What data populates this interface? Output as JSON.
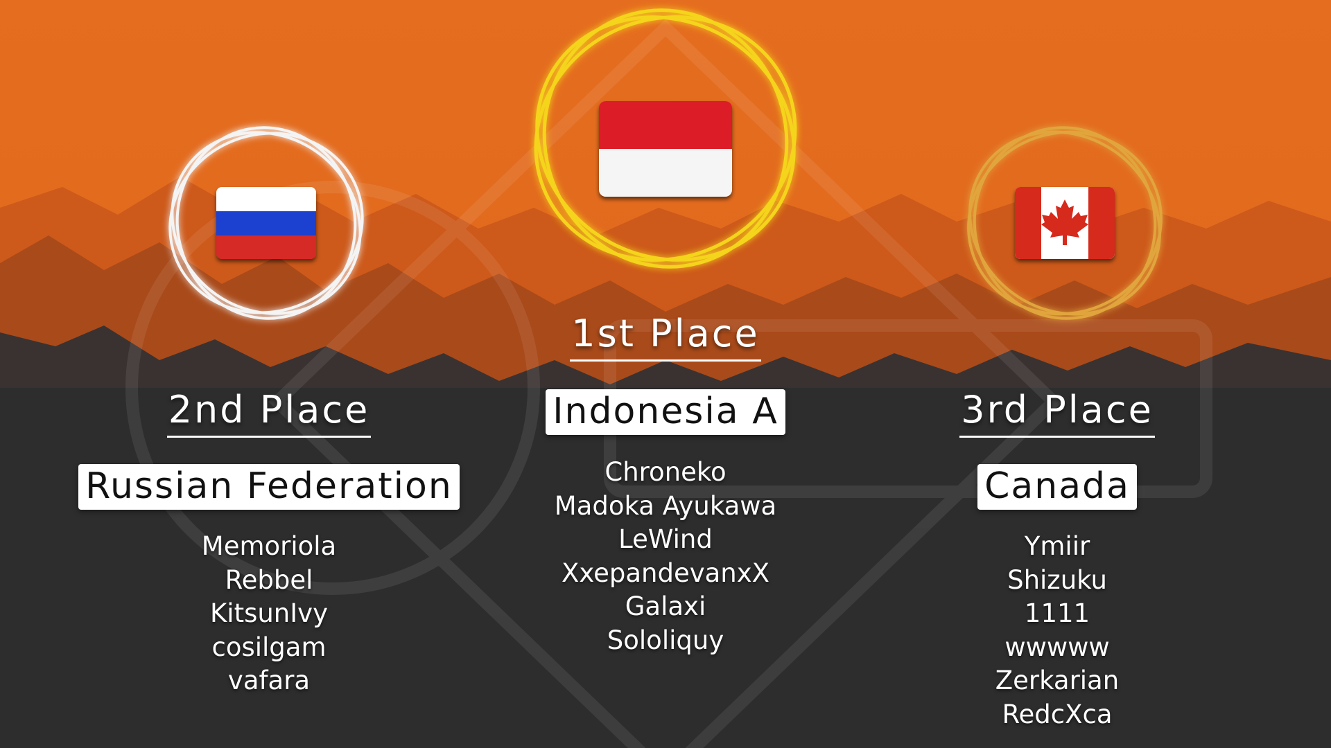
{
  "podiums": {
    "first": {
      "place": "1st Place",
      "team": "Indonesia A",
      "flag": "indonesia-flag",
      "ring_color": "#f2d22c",
      "players": [
        "Chroneko",
        "Madoka Ayukawa",
        "LeWind",
        "XxepandevanxX",
        "Galaxi",
        "Sololiquy"
      ]
    },
    "second": {
      "place": "2nd Place",
      "team": "Russian Federation",
      "flag": "russia-flag",
      "ring_color": "#e8e8e8",
      "players": [
        "Memoriola",
        "Rebbel",
        "KitsunIvy",
        "cosilgam",
        "vafara"
      ]
    },
    "third": {
      "place": "3rd Place",
      "team": "Canada",
      "flag": "canada-flag",
      "ring_color": "#e0a23a",
      "players": [
        "Ymiir",
        "Shizuku",
        "1111",
        "wwwww",
        "Zerkarian",
        "RedcXca"
      ]
    }
  },
  "colors": {
    "background_top": "#e0691e",
    "background_bottom": "#2b2b2b",
    "mountains": "#c4551a"
  }
}
